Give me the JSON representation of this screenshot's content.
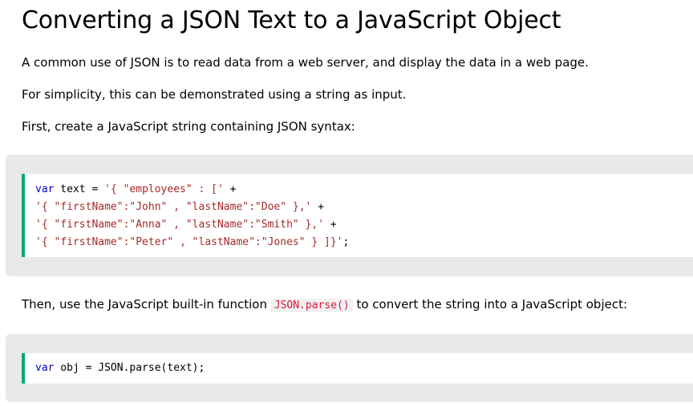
{
  "heading": "Converting a JSON Text to a JavaScript Object",
  "paragraphs": {
    "p1": "A common use of JSON is to read data from a web server, and display the data in a web page.",
    "p2": "For simplicity, this can be demonstrated using a string as input.",
    "p3": "First, create a JavaScript string containing JSON syntax:",
    "p4_before": "Then, use the JavaScript built-in function ",
    "p4_code": "JSON.parse()",
    "p4_after": " to convert the string into a JavaScript object:"
  },
  "example1": {
    "lines": [
      [
        {
          "t": "kw",
          "v": "var"
        },
        {
          "t": "plain",
          "v": " text = "
        },
        {
          "t": "str",
          "v": "'{ \"employees\" : ['"
        },
        {
          "t": "plain",
          "v": " +"
        }
      ],
      [
        {
          "t": "str",
          "v": "'{ \"firstName\":\"John\" , \"lastName\":\"Doe\" },'"
        },
        {
          "t": "plain",
          "v": " +"
        }
      ],
      [
        {
          "t": "str",
          "v": "'{ \"firstName\":\"Anna\" , \"lastName\":\"Smith\" },'"
        },
        {
          "t": "plain",
          "v": " +"
        }
      ],
      [
        {
          "t": "str",
          "v": "'{ \"firstName\":\"Peter\" , \"lastName\":\"Jones\" } ]}'"
        },
        {
          "t": "plain",
          "v": ";"
        }
      ]
    ]
  },
  "example2": {
    "lines": [
      [
        {
          "t": "kw",
          "v": "var"
        },
        {
          "t": "plain",
          "v": " obj = JSON.parse(text);"
        }
      ]
    ]
  },
  "colors": {
    "accent_border": "#04aa6d",
    "keyword": "#0000cd",
    "string": "#a52a2a",
    "inline_code": "#dc143c",
    "example_bg": "#e7e9eb"
  }
}
